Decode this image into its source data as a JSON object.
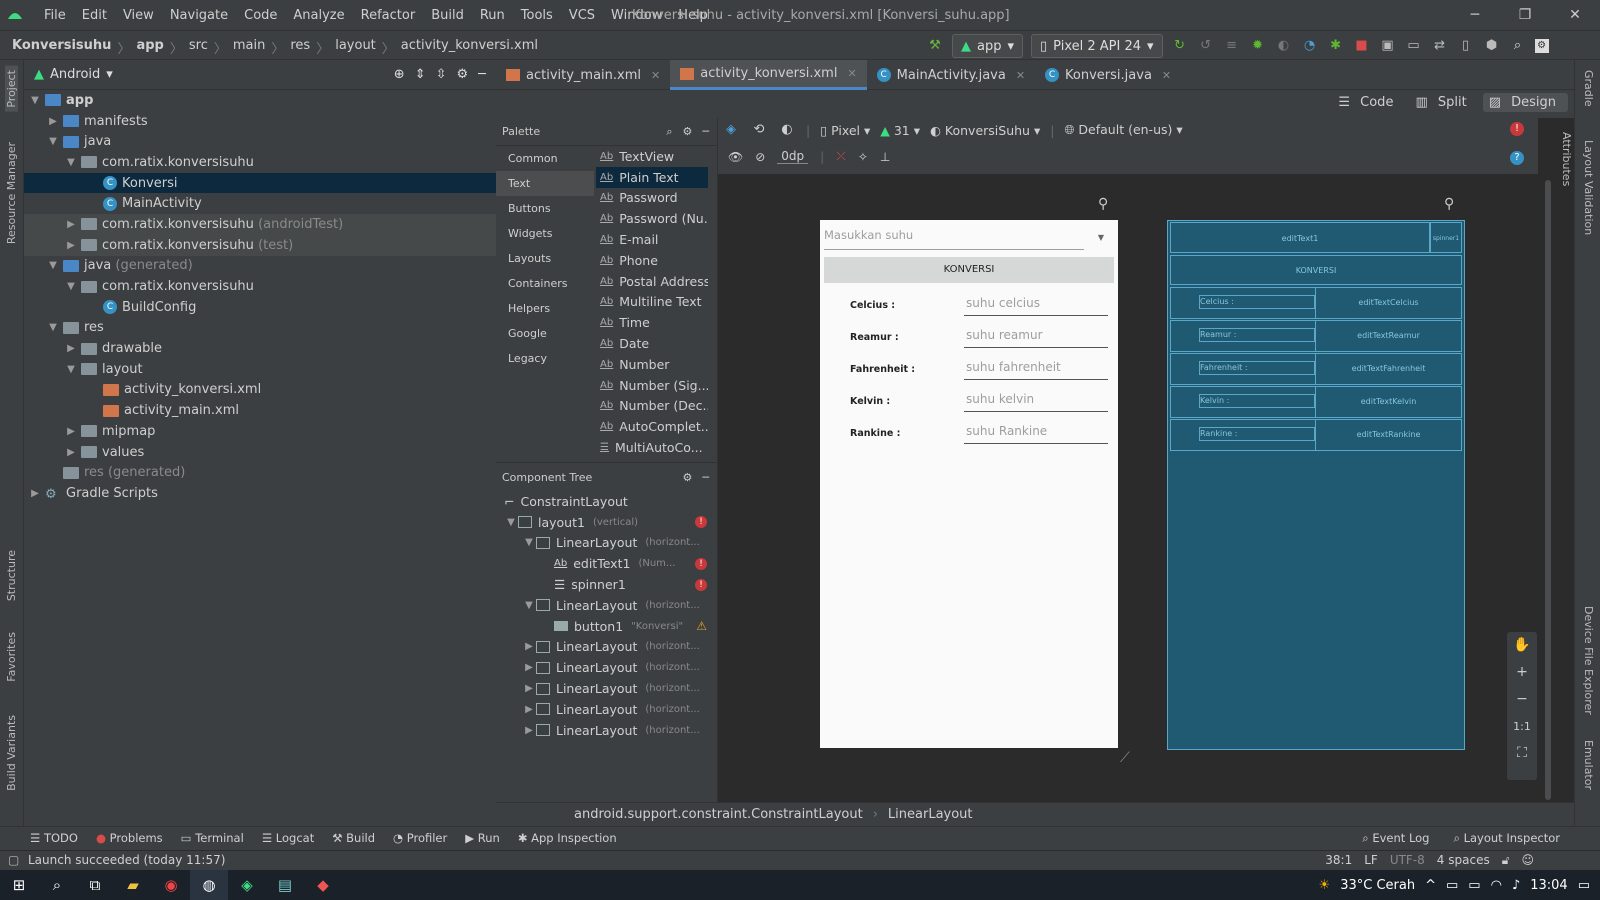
{
  "menubar": {
    "items": [
      "File",
      "Edit",
      "View",
      "Navigate",
      "Code",
      "Analyze",
      "Refactor",
      "Build",
      "Run",
      "Tools",
      "VCS",
      "Window",
      "Help"
    ],
    "window_title": "Konversi suhu - activity_konversi.xml [Konversi_suhu.app]"
  },
  "navbar": {
    "crumbs": [
      "Konversisuhu",
      "app",
      "src",
      "main",
      "res",
      "layout",
      "activity_konversi.xml"
    ],
    "run_config": "app",
    "device": "Pixel 2 API 24"
  },
  "project": {
    "view": "Android",
    "tree": [
      {
        "label": "app",
        "extra": ""
      },
      {
        "label": "manifests",
        "extra": ""
      },
      {
        "label": "java",
        "extra": ""
      },
      {
        "label": "com.ratix.konversisuhu",
        "extra": ""
      },
      {
        "label": "Konversi",
        "extra": ""
      },
      {
        "label": "MainActivity",
        "extra": ""
      },
      {
        "label": "com.ratix.konversisuhu",
        "extra": "(androidTest)"
      },
      {
        "label": "com.ratix.konversisuhu",
        "extra": "(test)"
      },
      {
        "label": "java",
        "extra": "(generated)"
      },
      {
        "label": "com.ratix.konversisuhu",
        "extra": ""
      },
      {
        "label": "BuildConfig",
        "extra": ""
      },
      {
        "label": "res",
        "extra": ""
      },
      {
        "label": "drawable",
        "extra": ""
      },
      {
        "label": "layout",
        "extra": ""
      },
      {
        "label": "activity_konversi.xml",
        "extra": ""
      },
      {
        "label": "activity_main.xml",
        "extra": ""
      },
      {
        "label": "mipmap",
        "extra": ""
      },
      {
        "label": "values",
        "extra": ""
      },
      {
        "label": "res",
        "extra": "(generated)"
      },
      {
        "label": "Gradle Scripts",
        "extra": ""
      }
    ]
  },
  "tabs": [
    "activity_main.xml",
    "activity_konversi.xml",
    "MainActivity.java",
    "Konversi.java"
  ],
  "design_modes": [
    "Code",
    "Split",
    "Design"
  ],
  "palette": {
    "title": "Palette",
    "categories": [
      "Common",
      "Text",
      "Buttons",
      "Widgets",
      "Layouts",
      "Containers",
      "Helpers",
      "Google",
      "Legacy"
    ],
    "items": [
      "TextView",
      "Plain Text",
      "Password",
      "Password (Nu...",
      "E-mail",
      "Phone",
      "Postal Address",
      "Multiline Text",
      "Time",
      "Date",
      "Number",
      "Number (Sig...",
      "Number (Dec...",
      "AutoComplet...",
      "MultiAutoCo..."
    ]
  },
  "canvas_toolbar": {
    "device": "Pixel",
    "api": "31",
    "theme": "KonversiSuhu",
    "locale": "Default (en-us)",
    "margin": "0dp"
  },
  "component_tree": {
    "title": "Component Tree",
    "nodes": [
      {
        "label": "ConstraintLayout",
        "sub": ""
      },
      {
        "label": "layout1",
        "sub": "(vertical)"
      },
      {
        "label": "LinearLayout",
        "sub": "(horizont..."
      },
      {
        "label": "editText1",
        "sub": "(Num..."
      },
      {
        "label": "spinner1",
        "sub": ""
      },
      {
        "label": "LinearLayout",
        "sub": "(horizont..."
      },
      {
        "label": "button1",
        "sub": "\"Konversi\""
      },
      {
        "label": "LinearLayout",
        "sub": "(horizont..."
      },
      {
        "label": "LinearLayout",
        "sub": "(horizont..."
      },
      {
        "label": "LinearLayout",
        "sub": "(horizont..."
      },
      {
        "label": "LinearLayout",
        "sub": "(horizont..."
      },
      {
        "label": "LinearLayout",
        "sub": "(horizont..."
      }
    ]
  },
  "preview": {
    "spinner_hint": "Masukkan suhu",
    "button": "KONVERSI",
    "rows": [
      {
        "label": "Celcius :",
        "hint": "suhu celcius"
      },
      {
        "label": "Reamur :",
        "hint": "suhu reamur"
      },
      {
        "label": "Fahrenheit :",
        "hint": "suhu fahrenheit"
      },
      {
        "label": "Kelvin :",
        "hint": "suhu kelvin"
      },
      {
        "label": "Rankine :",
        "hint": "suhu Rankine"
      }
    ]
  },
  "blueprint": {
    "edit": "editText1",
    "spinner": "spinner1",
    "button": "KONVERSI",
    "rows": [
      {
        "label": "Celcius :",
        "id": "editTextCelcius"
      },
      {
        "label": "Reamur :",
        "id": "editTextReamur"
      },
      {
        "label": "Fahrenheit :",
        "id": "editTextFahrenheit"
      },
      {
        "label": "Kelvin :",
        "id": "editTextKelvin"
      },
      {
        "label": "Rankine :",
        "id": "editTextRankine"
      }
    ]
  },
  "zoom": [
    "+",
    "−",
    "1:1"
  ],
  "bottom_crumbs": [
    "android.support.constraint.ConstraintLayout",
    "LinearLayout"
  ],
  "bottom_tabs": [
    "TODO",
    "Problems",
    "Terminal",
    "Logcat",
    "Build",
    "Profiler",
    "Run",
    "App Inspection"
  ],
  "bottom_right_tabs": [
    "Event Log",
    "Layout Inspector"
  ],
  "status": {
    "message": "Launch succeeded (today 11:57)",
    "position": "38:1",
    "line_sep": "LF",
    "encoding": "UTF-8",
    "indent": "4 spaces"
  },
  "left_strip": [
    "Project",
    "Resource Manager",
    "Structure",
    "Favorites",
    "Build Variants"
  ],
  "right_strip": [
    "Gradle",
    "Attributes",
    "Layout Validation",
    "Device File Explorer",
    "Emulator"
  ],
  "taskbar": {
    "weather": "33°C Cerah",
    "time": "13:04"
  },
  "colors": {
    "accent": "#4a88c7",
    "selection": "#0d293e",
    "blueprint": "#1f5a72"
  }
}
